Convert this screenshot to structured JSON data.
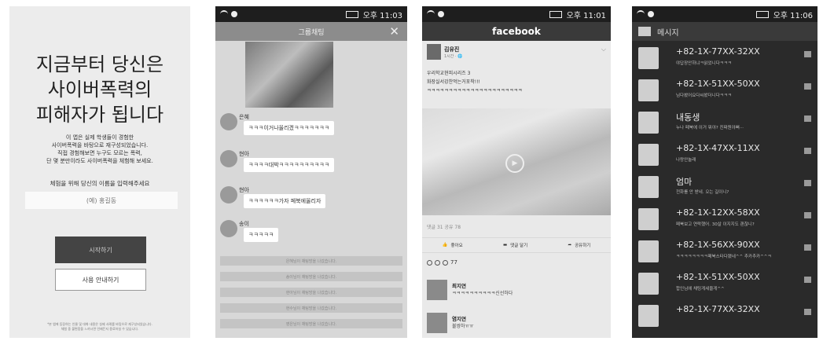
{
  "status": {
    "time": "오후 11:06",
    "time2": "오후 11:03",
    "time3": "오후 11:01"
  },
  "screen1": {
    "title_lines": [
      "지금부터 당신은",
      "사이버폭력의",
      "피해자가 됩니다"
    ],
    "desc_lines": [
      "이 앱은 실제 학생들이 경험한",
      "사이버폭력을 바탕으로 재구성되었습니다.",
      "직접 경험해보면 누구도 모르는 폭력,",
      "단 몇 분만이라도 사이버폭력을 체험해 보세요."
    ],
    "name_prompt": "체험을 위해 당신의 이름을 입력해주세요",
    "name_placeholder": "(예) 홍길동",
    "start_button": "시작하기",
    "consent_button": "사용 안내하기",
    "footer_lines": [
      "*본 앱에 등장하는 인물 및 대화 내용은 실제 사례를 바탕으로 재구성되었습니다.",
      "체험 중 불편함을 느끼시면 언제든지 종료하실 수 있습니다."
    ]
  },
  "screen2": {
    "title": "그룹채팅",
    "close": "✕",
    "messages": [
      {
        "sender": "은혜",
        "text": "ㅋㅋㅋ이거나올리겠ㅋㅋㅋㅋㅋㅋㅋ"
      },
      {
        "sender": "현아",
        "text": "ㅋㅋㅋㅋ대박ㅋㅋㅋㅋㅋㅋㅋㅋㅋㅋ"
      },
      {
        "sender": "현아",
        "text": "ㅋㅋㅋㅋㅋㅋ가자 페북에올리자"
      },
      {
        "sender": "송이",
        "text": "ㅋㅋㅋㅋㅋ"
      }
    ],
    "notices": [
      "은혜님이 채팅방을 나갔습니다.",
      "송이님이 채팅방을 나갔습니다.",
      "현아님이 채팅방을 나갔습니다.",
      "현수님이 채팅방을 나갔습니다.",
      "영은님이 채팅방을 나갔습니다."
    ]
  },
  "screen3": {
    "app_title": "facebook",
    "author": "김유진",
    "time": "1시간 · 🌐",
    "post_lines": [
      "우리학교현피시리즈 3",
      "화장실서강찬먹는거포착!!!",
      "ㅋㅋㅋㅋㅋㅋㅋㅋㅋㅋㅋㅋㅋㅋㅋㅋㅋㅋㅋㅋㅋㅋ"
    ],
    "stats": "댓글 31 공유 78",
    "actions": [
      {
        "icon": "like-icon",
        "label": "좋아요"
      },
      {
        "icon": "comment-icon",
        "label": "댓글 달기"
      },
      {
        "icon": "share-icon",
        "label": "공유하기"
      }
    ],
    "reactions_count": "77",
    "comments": [
      {
        "name": "최지연",
        "text": "ㅋㅋㅋㅋㅋㅋㅋㅋㅋㅋ신선하다"
      },
      {
        "name": "염지연",
        "text": "불쌍하ㅠㅠ"
      }
    ]
  },
  "screen4": {
    "title": "메시지",
    "messages": [
      {
        "name": "+82-1X-77XX-32XX",
        "preview": "야답장안하냐ㅋ읽었니다ㅋㅋㅋ"
      },
      {
        "name": "+82-1X-51XX-50XX",
        "preview": "님다봤어요다씨봤더니다ㅋㅋㅋ"
      },
      {
        "name": "내동생",
        "preview": "누나 페북에 이거 뭐야? 진짜뭔야뻐···"
      },
      {
        "name": "+82-1X-47XX-11XX",
        "preview": "나랑안놀래"
      },
      {
        "name": "엄마",
        "preview": "전화를 안 받네. 오는 길이니?"
      },
      {
        "name": "+82-1X-12XX-58XX",
        "preview": "페북보고 연락했어. 30살 이지지도 괜찮니?"
      },
      {
        "name": "+82-1X-56XX-90XX",
        "preview": "ㅋㅋㅋㅋㅋㅋㅋㅋ페북스타다됐네^^ 추카추카^^ㅋ"
      },
      {
        "name": "+82-1X-51XX-50XX",
        "preview": "합인님에 채팅게세울게^^"
      },
      {
        "name": "+82-1X-77XX-32XX",
        "preview": ""
      }
    ]
  }
}
